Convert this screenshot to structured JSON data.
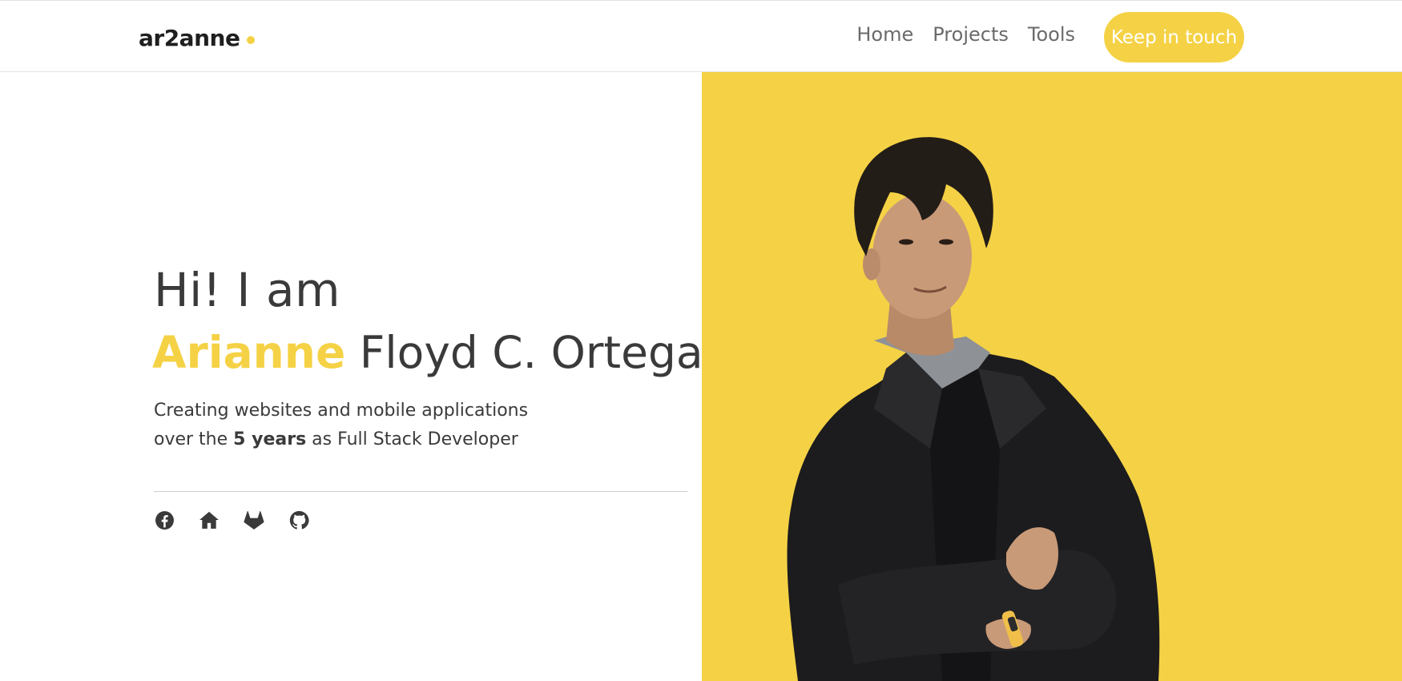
{
  "colors": {
    "accent": "#f5d245",
    "text": "#3a3a3a",
    "nav_text": "#6b6b6b",
    "suit": "#1c1c1e",
    "shirt": "#8e9196",
    "skin": "#c99a78",
    "hair": "#231d18"
  },
  "navbar": {
    "brand": "ar2anne",
    "links": [
      "Home",
      "Projects",
      "Tools"
    ],
    "cta_label": "Keep in touch"
  },
  "hero": {
    "greeting": "Hi! I am",
    "first_name": "Arianne",
    "rest_name": " Floyd C. Ortega",
    "tagline_line1": "Creating websites and mobile applications",
    "tagline_line2_prefix": "over the ",
    "tagline_line2_bold": "5 years",
    "tagline_line2_suffix": " as Full Stack Developer"
  },
  "socials": [
    {
      "icon": "facebook-icon"
    },
    {
      "icon": "home-icon"
    },
    {
      "icon": "gitlab-icon"
    },
    {
      "icon": "github-icon"
    }
  ]
}
